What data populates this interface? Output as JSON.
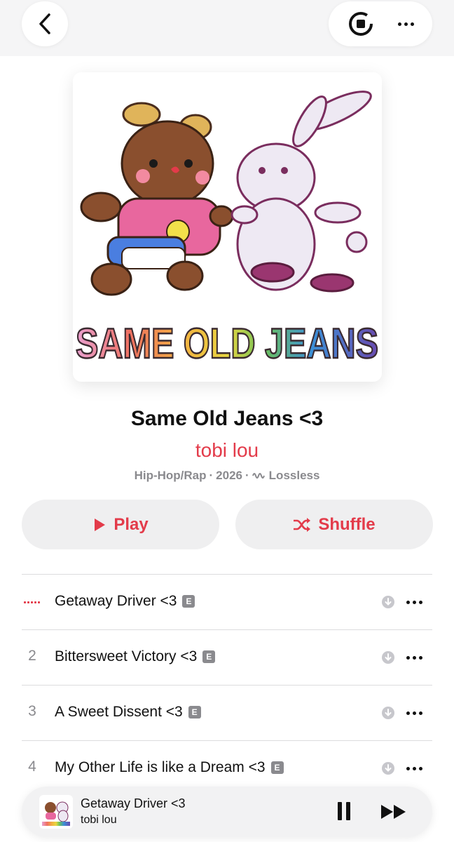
{
  "album": {
    "title": "Same Old Jeans <3",
    "artist": "tobi lou",
    "genre": "Hip-Hop/Rap",
    "year": "2026",
    "quality": "Lossless",
    "artwork_text": "SAME OLD JEANS"
  },
  "actions": {
    "play_label": "Play",
    "shuffle_label": "Shuffle"
  },
  "tracks": [
    {
      "number": "",
      "title": "Getaway Driver <3",
      "explicit": "E",
      "playing": true
    },
    {
      "number": "2",
      "title": "Bittersweet Victory <3",
      "explicit": "E",
      "playing": false
    },
    {
      "number": "3",
      "title": "A Sweet Dissent <3",
      "explicit": "E",
      "playing": false
    },
    {
      "number": "4",
      "title": "My Other Life is like a Dream <3",
      "explicit": "E",
      "playing": false
    }
  ],
  "now_playing": {
    "title": "Getaway Driver <3",
    "artist": "tobi lou"
  },
  "colors": {
    "accent": "#e33b4a",
    "secondary_text": "#8a8a8e",
    "button_bg": "#efeff0"
  },
  "icons": [
    "back-chevron-icon",
    "stop-download-icon",
    "more-icon",
    "play-icon",
    "shuffle-icon",
    "download-icon",
    "pause-icon",
    "fast-forward-icon",
    "lossless-icon"
  ]
}
